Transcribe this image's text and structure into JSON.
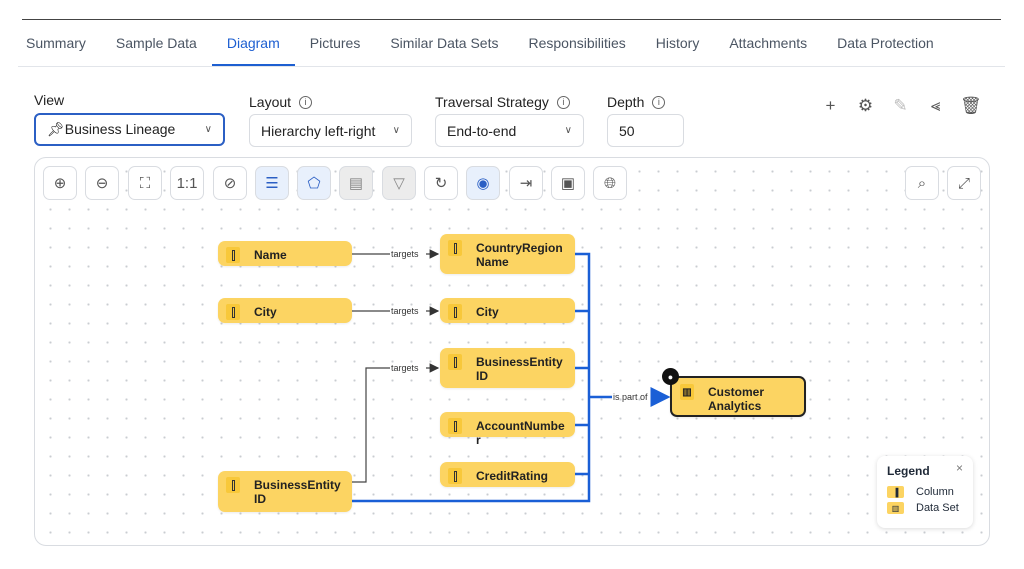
{
  "tabs": [
    "Summary",
    "Sample Data",
    "Diagram",
    "Pictures",
    "Similar Data Sets",
    "Responsibilities",
    "History",
    "Attachments",
    "Data Protection"
  ],
  "active_tab": "Diagram",
  "fields": {
    "view": {
      "label": "View",
      "value": "Business Lineage",
      "icon": "pin-icon"
    },
    "layout": {
      "label": "Layout",
      "value": "Hierarchy left-right"
    },
    "traversal": {
      "label": "Traversal Strategy",
      "value": "End-to-end"
    },
    "depth": {
      "label": "Depth",
      "value": "50"
    }
  },
  "actions": [
    "add-icon",
    "gear-icon",
    "edit-icon",
    "share-icon",
    "trash-icon"
  ],
  "toolbar": [
    "zoom-in",
    "zoom-out",
    "fit",
    "1:1",
    "compass",
    "list",
    "tag",
    "details",
    "filter",
    "refresh",
    "eye",
    "export",
    "camera",
    "globe"
  ],
  "toolbar_right": [
    "search",
    "expand"
  ],
  "zoom_one_label": "1:1",
  "nodes": {
    "name": "Name",
    "city_src": "City",
    "bei_src": "BusinessEntityID",
    "crn": "CountryRegionName",
    "city_tgt": "City",
    "bei_tgt": "BusinessEntityID",
    "acct": "AccountNumber",
    "credit": "CreditRating",
    "dataset": "Customer Analytics"
  },
  "edge_labels": {
    "targets": "targets",
    "part_of": "is part of"
  },
  "legend": {
    "title": "Legend",
    "close": "×",
    "items": [
      "Column",
      "Data Set"
    ]
  },
  "colors": {
    "accent": "#1d5fd1",
    "node": "#fcd462",
    "edge_part_of": "#1a5fd6"
  }
}
